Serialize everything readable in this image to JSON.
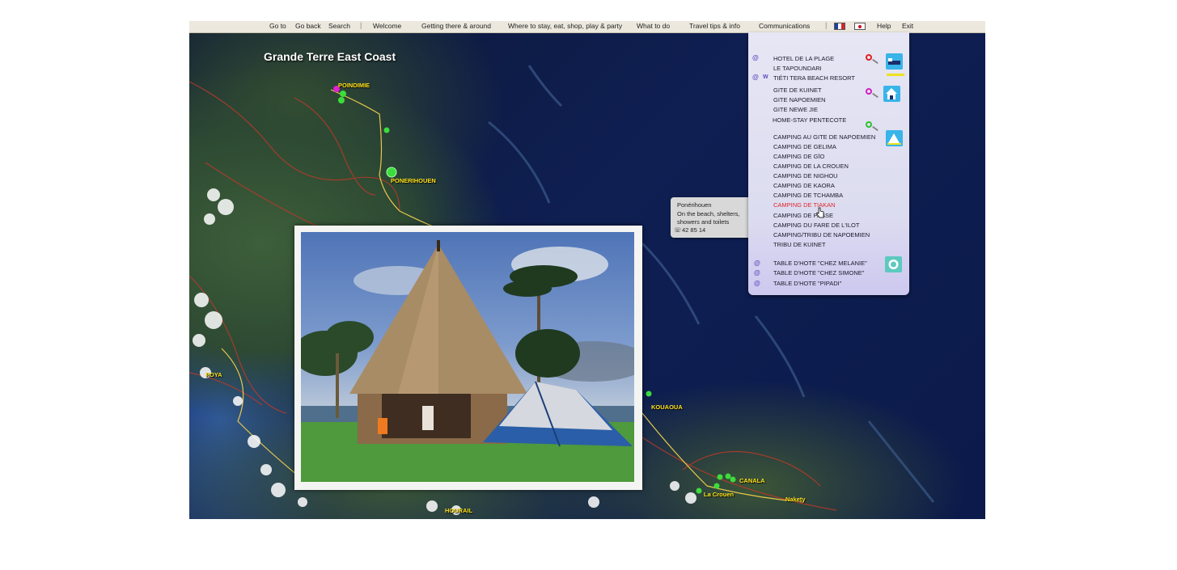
{
  "nav": {
    "items": [
      "Go to",
      "Go back",
      "Search",
      "Welcome",
      "Getting there & around",
      "Where to stay, eat, shop, play & party",
      "What to do",
      "Travel tips & info",
      "Communications",
      "Help",
      "Exit"
    ],
    "separators": [
      "|",
      "|"
    ]
  },
  "map": {
    "title": "Grande Terre East Coast",
    "places": [
      "POINDIMIE",
      "PONERIHOUEN",
      "POYA",
      "KOUAOUA",
      "CANALA",
      "La Crouen",
      "Nakety",
      "HOURAIL"
    ]
  },
  "tooltip": {
    "name": "Ponérihouen",
    "line1": "On the beach, shelters,",
    "line2": "showers and toilets",
    "phone_icon": "phone-icon",
    "phone": "42 85 14"
  },
  "panel": {
    "at_symbol": "@",
    "web_symbol": "W",
    "hotels": [
      "HOTEL DE LA PLAGE",
      "LE TAPOUNDARI",
      "TIÉTI TERA BEACH RESORT"
    ],
    "gites": [
      "GITE DE KUINET",
      "GITE NAPOEMIEN",
      "GITE NEWE JIE",
      "HOME-STAY PENTECOTE"
    ],
    "campings": [
      "CAMPING AU GITE DE NAPOEMIEN",
      "CAMPING DE GELIMA",
      "CAMPING DE GÏO",
      "CAMPING DE LA CROUEN",
      "CAMPING DE NIGHOU",
      "CAMPING DE KAORA",
      "CAMPING DE TCHAMBA",
      "CAMPING DE TIAKAN",
      "CAMPING DE PASSE",
      "CAMPING DU FARE DE L'ILOT",
      "CAMPING/TRIBU DE NAPOEMIEN",
      "TRIBU DE KUINET"
    ],
    "tables": [
      "TABLE D'HOTE \"CHEZ MELANIE\"",
      "TABLE D'HOTE \"CHEZ SIMONE\"",
      "TABLE D'HOTE \"PIPADI\""
    ],
    "icons": [
      "hotel-bed-icon",
      "gite-house-icon",
      "camping-tent-icon",
      "table-hote-plate-icon"
    ],
    "active_item": "CAMPING DE TIAKAN"
  },
  "colors": {
    "accent_active": "#e0262a",
    "place_label": "#ffe21a",
    "panel_bg": "#e6e6f4",
    "marker_green": "#3cdc3c",
    "marker_magenta": "#e01fd0"
  }
}
